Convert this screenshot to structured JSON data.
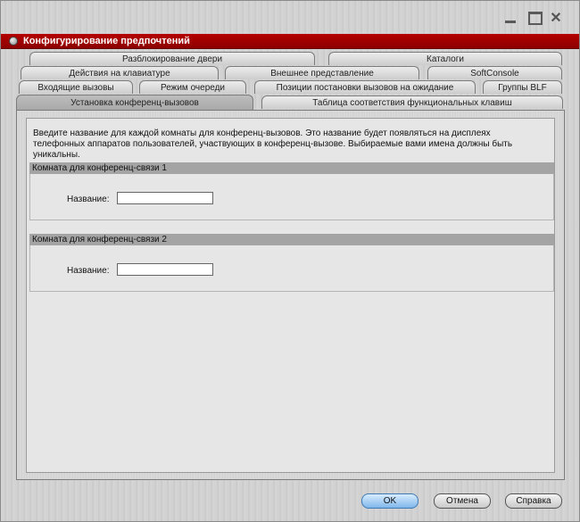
{
  "window": {
    "title": "Конфигурирование предпочтений",
    "controls": {
      "minimize_icon": "minimize-icon",
      "maximize_icon": "maximize-icon",
      "close_icon": "close-icon",
      "close_glyph": "✕"
    }
  },
  "tabs": [
    {
      "label": "Разблокирование двери"
    },
    {
      "label": "Каталоги"
    },
    {
      "label": "Действия на клавиатуре"
    },
    {
      "label": "Внешнее представление"
    },
    {
      "label": "SoftConsole"
    },
    {
      "label": "Входящие вызовы"
    },
    {
      "label": "Режим очереди"
    },
    {
      "label": "Позиции постановки вызовов на ожидание"
    },
    {
      "label": "Группы BLF"
    },
    {
      "label": "Установка конференц-вызовов",
      "active": true
    },
    {
      "label": "Таблица соответствия функциональных клавиш"
    }
  ],
  "main": {
    "description": "Введите название для каждой комнаты для конференц-вызовов. Это название будет появляться на дисплеях телефонных аппаратов пользователей, участвующих в конференц-вызове. Выбираемые вами имена должны быть уникальны.",
    "rooms": [
      {
        "header": "Комната для конференц-связи 1",
        "name_label": "Название:",
        "name_value": ""
      },
      {
        "header": "Комната для конференц-связи 2",
        "name_label": "Название:",
        "name_value": ""
      }
    ]
  },
  "buttons": {
    "ok": "OK",
    "cancel": "Отмена",
    "help": "Справка"
  },
  "colors": {
    "title_bar": "#a00000",
    "primary_button": "#7fb6ea"
  }
}
